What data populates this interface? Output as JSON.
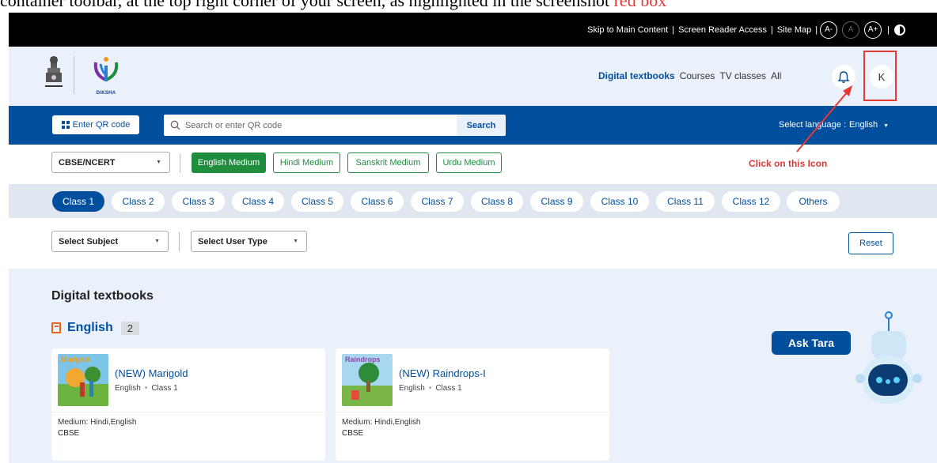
{
  "caption": {
    "text": "container toolbar, at the top right corner of your screen, as highlighted in the screenshot",
    "highlight": "red box"
  },
  "access": {
    "skip": "Skip to Main Content",
    "reader": "Screen Reader Access",
    "sitemap": "Site Map",
    "font_minus": "A-",
    "font_normal": "A",
    "font_plus": "A+"
  },
  "header": {
    "brand": "DIKSHA",
    "nav": [
      "Digital textbooks",
      "Courses",
      "TV classes",
      "All"
    ],
    "avatar_initial": "K"
  },
  "search": {
    "qr_label": "Enter QR code",
    "placeholder": "Search or enter QR code",
    "button": "Search",
    "lang_label": "Select language :",
    "lang_value": "English"
  },
  "filters": {
    "board": "CBSE/NCERT",
    "mediums": [
      "English Medium",
      "Hindi Medium",
      "Sanskrit Medium",
      "Urdu Medium"
    ],
    "subject": "Select Subject",
    "user_type": "Select User Type",
    "reset": "Reset"
  },
  "annotation": {
    "note": "Click on this Icon"
  },
  "classes": [
    "Class 1",
    "Class 2",
    "Class 3",
    "Class 4",
    "Class 5",
    "Class 6",
    "Class 7",
    "Class 8",
    "Class 9",
    "Class 10",
    "Class 11",
    "Class 12",
    "Others"
  ],
  "content": {
    "section_title": "Digital textbooks",
    "subject": "English",
    "count": "2",
    "books": [
      {
        "title": "(NEW) Marigold",
        "language": "English",
        "class": "Class 1",
        "medium": "Medium: Hindi,English",
        "board": "CBSE"
      },
      {
        "title": "(NEW) Raindrops-I",
        "language": "English",
        "class": "Class 1",
        "medium": "Medium: Hindi,English",
        "board": "CBSE"
      }
    ]
  },
  "chatbot": {
    "label": "Ask Tara"
  }
}
